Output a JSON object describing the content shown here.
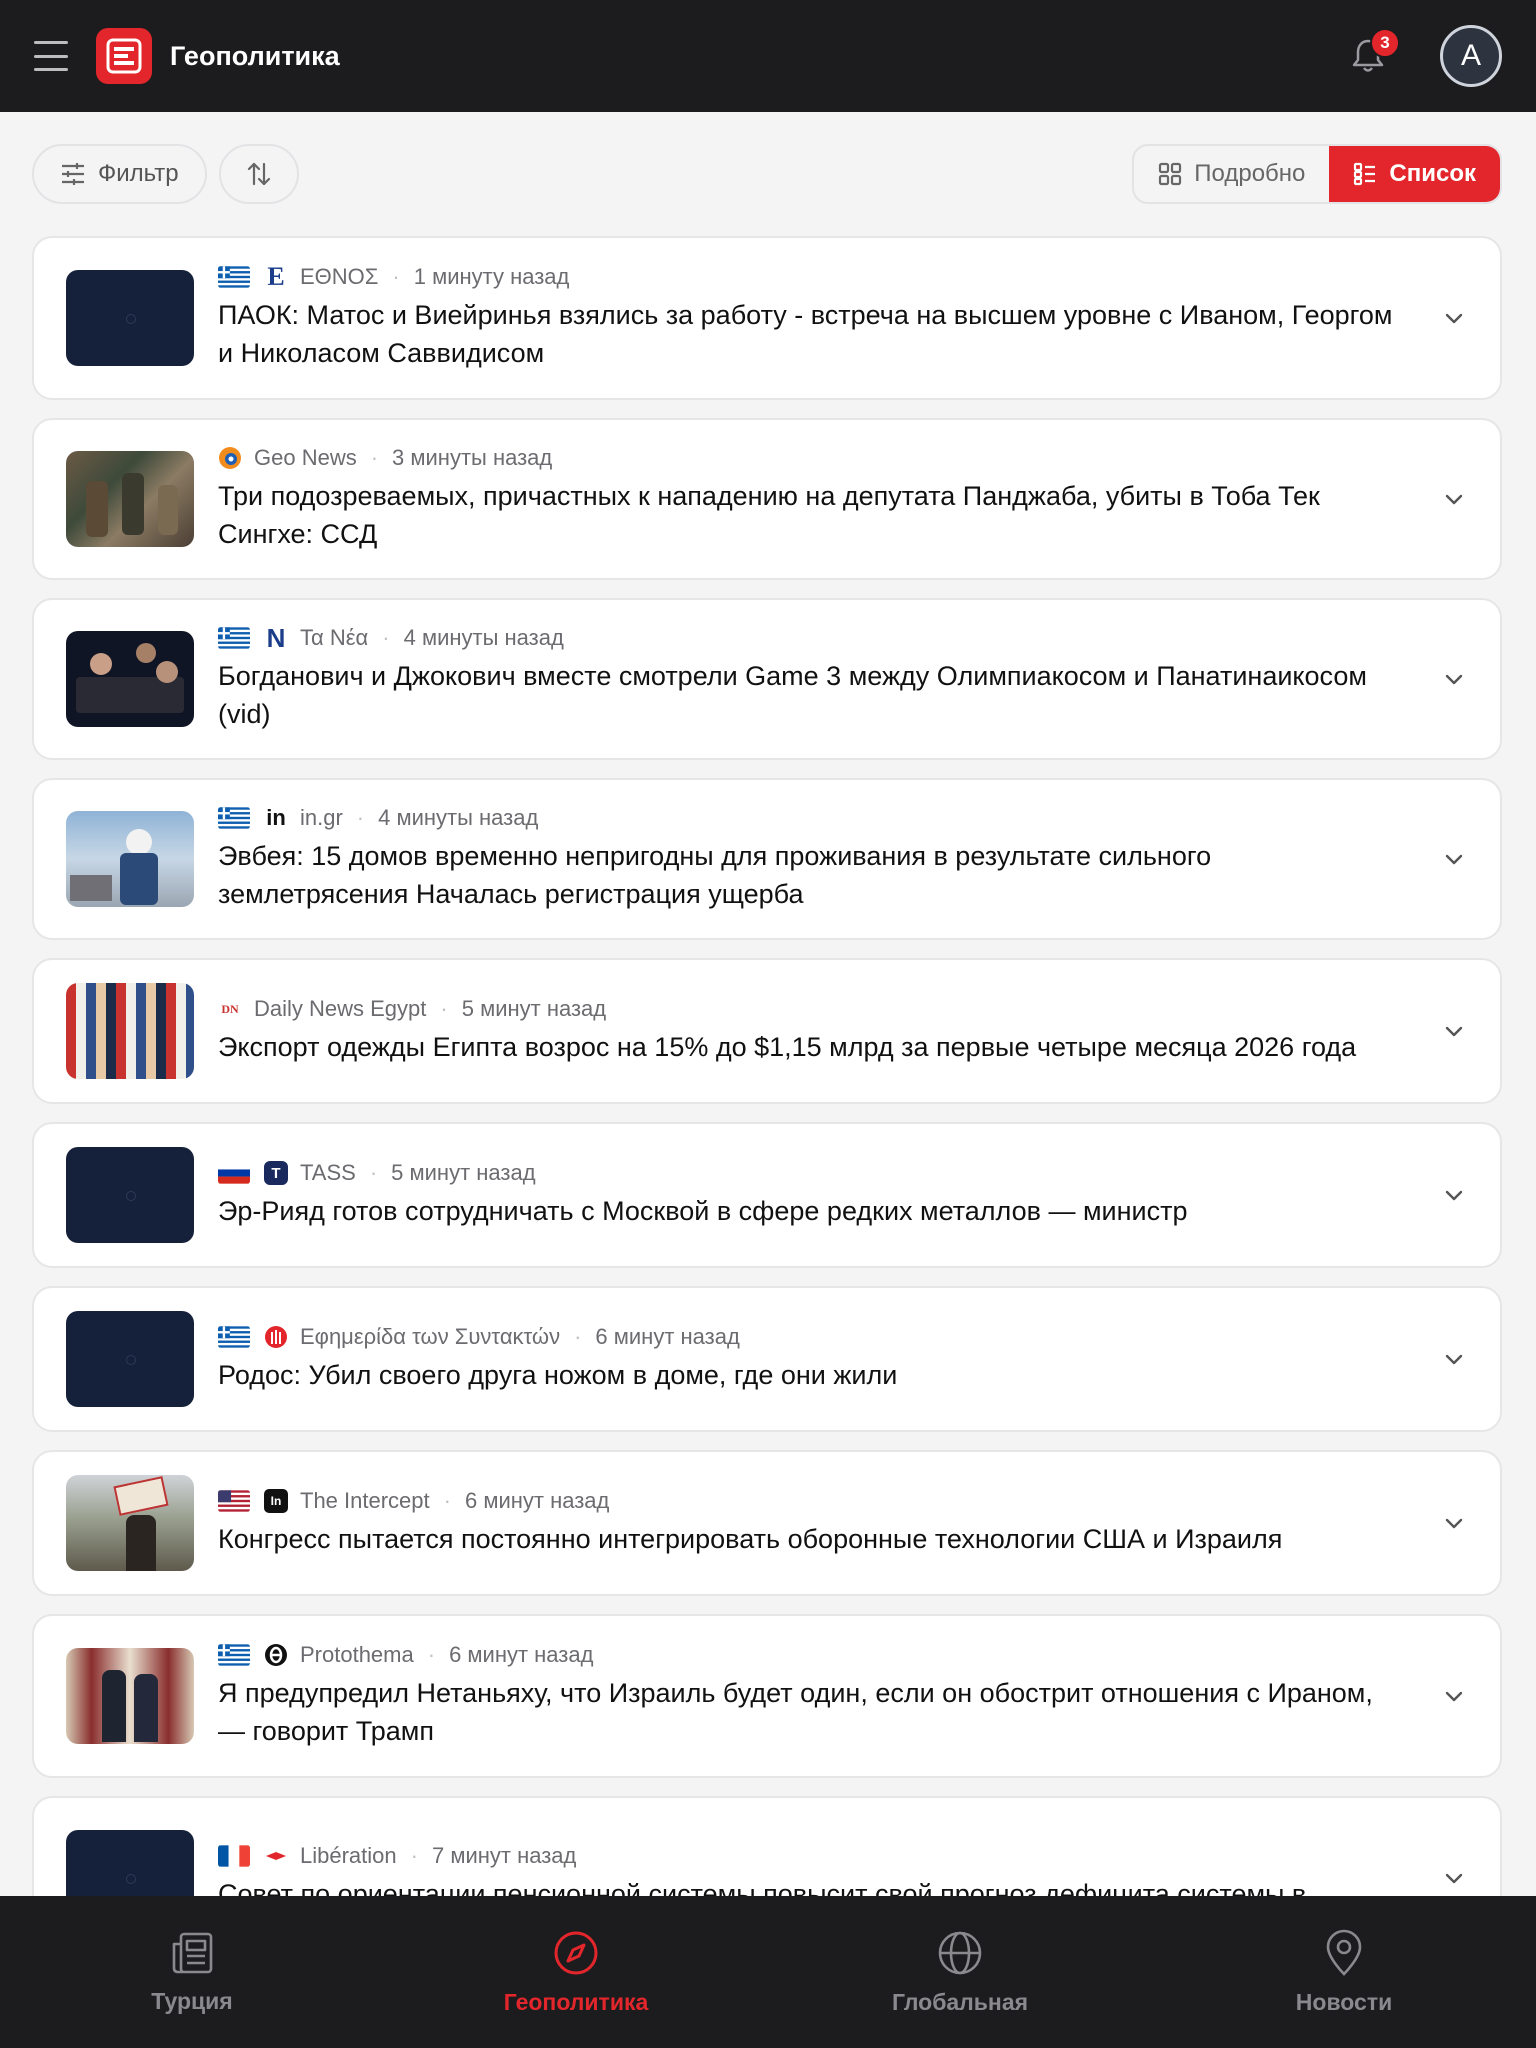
{
  "header": {
    "title": "Геополитика",
    "notification_count": "3",
    "avatar_initial": "A"
  },
  "toolbar": {
    "filter_label": "Фильтр",
    "view_detailed_label": "Подробно",
    "view_list_label": "Список",
    "active_view": "list"
  },
  "articles": [
    {
      "country": "greece",
      "source": "ΕΘΝΟΣ",
      "time": "1 минуту назад",
      "headline": "ПАОК: Матос и Виейринья взялись за работу - встреча на высшем уровне с Иваном, Георгом и Николасом Саввидисом"
    },
    {
      "country": "none",
      "source": "Geo News",
      "time": "3 минуты назад",
      "headline": "Три подозреваемых, причастных к нападению на депутата Панджаба, убиты в Тоба Тек Сингхе: ССД"
    },
    {
      "country": "greece",
      "source": "Τα Νέα",
      "time": "4 минуты назад",
      "headline": "Богданович и Джокович вместе смотрели Game 3 между Олимпиакосом и Панатинаикосом (vid)"
    },
    {
      "country": "greece",
      "source": "in.gr",
      "time": "4 минуты назад",
      "headline": "Эвбея: 15 домов временно непригодны для проживания в результате сильного землетрясения Началась регистрация ущерба"
    },
    {
      "country": "none",
      "source": "Daily News Egypt",
      "time": "5 минут назад",
      "headline": "Экспорт одежды Египта возрос на 15% до $1,15 млрд за первые четыре месяца 2026 года"
    },
    {
      "country": "russia",
      "source": "TASS",
      "time": "5 минут назад",
      "headline": "Эр-Рияд готов сотрудничать с Москвой в сфере редких металлов — министр"
    },
    {
      "country": "greece",
      "source": "Εφημερίδα των Συντακτών",
      "time": "6 минут назад",
      "headline": "Родос: Убил своего друга ножом в доме, где они жили"
    },
    {
      "country": "usa",
      "source": "The Intercept",
      "time": "6 минут назад",
      "headline": "Конгресс пытается постоянно интегрировать оборонные технологии США и Израиля"
    },
    {
      "country": "greece",
      "source": "Protothema",
      "time": "6 минут назад",
      "headline": "Я предупредил Нетаньяху, что Израиль будет один, если он обострит отношения с Ираном, — говорит Трамп"
    },
    {
      "country": "france",
      "source": "Libération",
      "time": "7 минут назад",
      "headline": "Совет по ориентации пенсионной системы повысит свой прогноз дефицита системы в"
    }
  ],
  "bottom_nav": [
    {
      "label": "Турция",
      "icon": "newspaper-icon"
    },
    {
      "label": "Геополитика",
      "icon": "compass-icon",
      "active": true
    },
    {
      "label": "Глобальная",
      "icon": "globe-icon"
    },
    {
      "label": "Новости",
      "icon": "location-pin-icon"
    }
  ],
  "colors": {
    "accent": "#e3262b",
    "bar_bg": "#1c1c1e",
    "page_bg": "#f4f4f5"
  }
}
